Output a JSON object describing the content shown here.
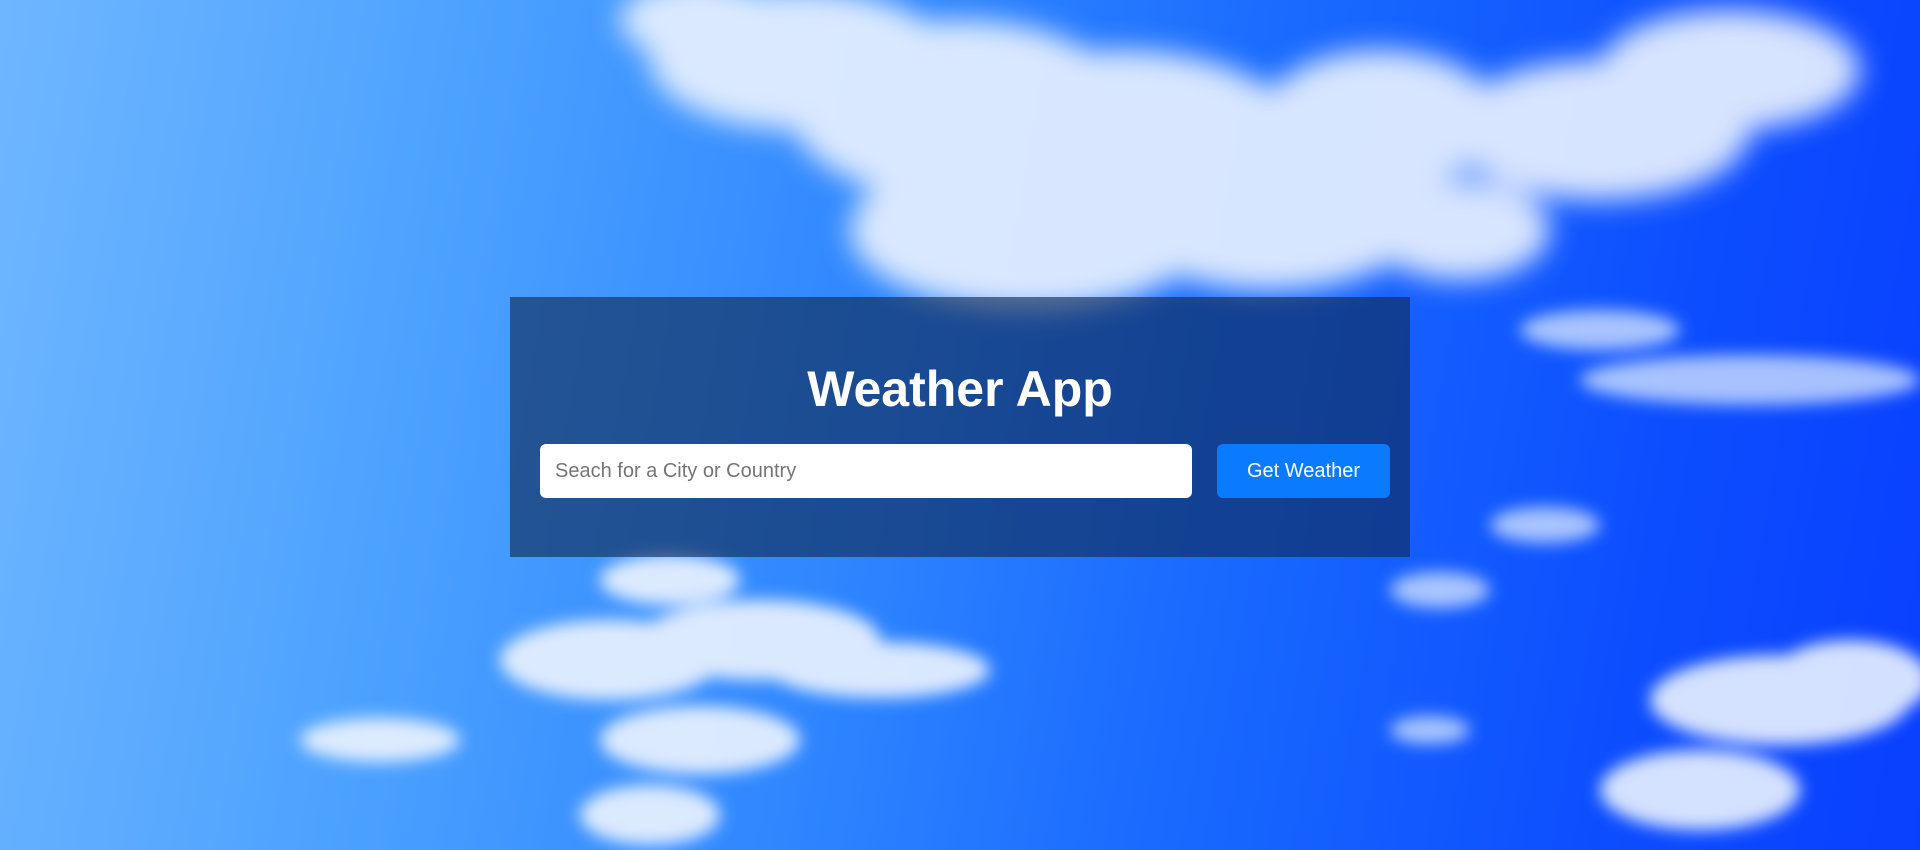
{
  "app": {
    "title": "Weather App"
  },
  "search": {
    "placeholder": "Seach for a City or Country",
    "value": "",
    "button_label": "Get Weather"
  },
  "colors": {
    "panel_overlay": "#0f2850",
    "button": "#0a7bff",
    "title_text": "#ffffff",
    "sky_light": "#6fb6ff",
    "sky_deep": "#0a3fff"
  },
  "background": {
    "icon": "sky-with-clouds"
  }
}
